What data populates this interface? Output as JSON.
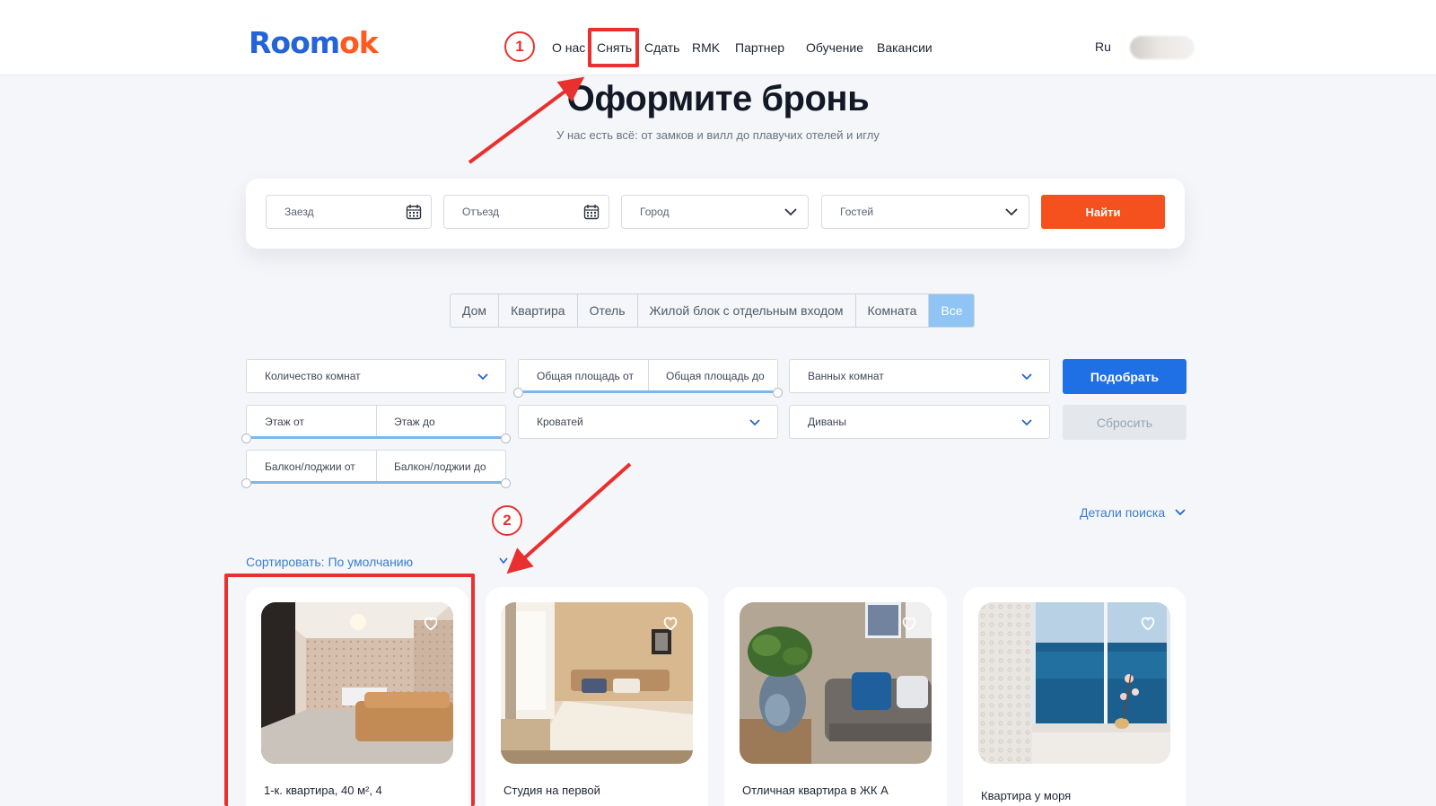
{
  "header": {
    "logo_part1": "Room",
    "logo_part2": "ok",
    "logo_middle_letters": "oo",
    "nav": [
      "О нас",
      "Снять",
      "Сдать",
      "RMK",
      "Партнер",
      "Обучение",
      "Вакансии"
    ],
    "language": "Ru"
  },
  "hero": {
    "title": "Оформите бронь",
    "subtitle": "У нас есть всё: от замков и вилл до плавучих отелей и иглу"
  },
  "search": {
    "checkin": "Заезд",
    "checkout": "Отъезд",
    "city": "Город",
    "guests": "Гостей",
    "find_button": "Найти"
  },
  "property_types": {
    "items": [
      "Дом",
      "Квартира",
      "Отель",
      "Жилой блок с отдельным входом",
      "Комната",
      "Все"
    ],
    "active": "Все"
  },
  "filters": {
    "rooms": "Количество комнат",
    "area_from": "Общая площадь от",
    "area_to": "Общая площадь до",
    "bathrooms": "Ванных комнат",
    "floor_from": "Этаж от",
    "floor_to": "Этаж до",
    "beds": "Кроватей",
    "sofas": "Диваны",
    "balcony_from": "Балкон/лоджии от",
    "balcony_to": "Балкон/лоджии до",
    "pick_button": "Подобрать",
    "reset_button": "Сбросить"
  },
  "search_details": "Детали поиска",
  "sort": {
    "label": "Сортировать:",
    "value": "По умолчанию"
  },
  "listings": [
    {
      "title": "1-к. квартира, 40 м², 4",
      "favorite_icon": "heart-icon"
    },
    {
      "title": "Студия на первой",
      "favorite_icon": "heart-icon"
    },
    {
      "title": "Отличная квартира в ЖК А",
      "favorite_icon": "heart-icon"
    },
    {
      "title": "Квартира у моря",
      "favorite_icon": "heart-icon"
    }
  ],
  "annotations": {
    "step1": "1",
    "step2": "2",
    "color": "#e8312e"
  },
  "colors": {
    "brand_blue": "#2563d9",
    "brand_orange": "#ff5a1f",
    "find_button": "#f4511e",
    "pick_button": "#1f6fe5",
    "active_type": "#8fc4f4",
    "link": "#3b7fd0"
  }
}
